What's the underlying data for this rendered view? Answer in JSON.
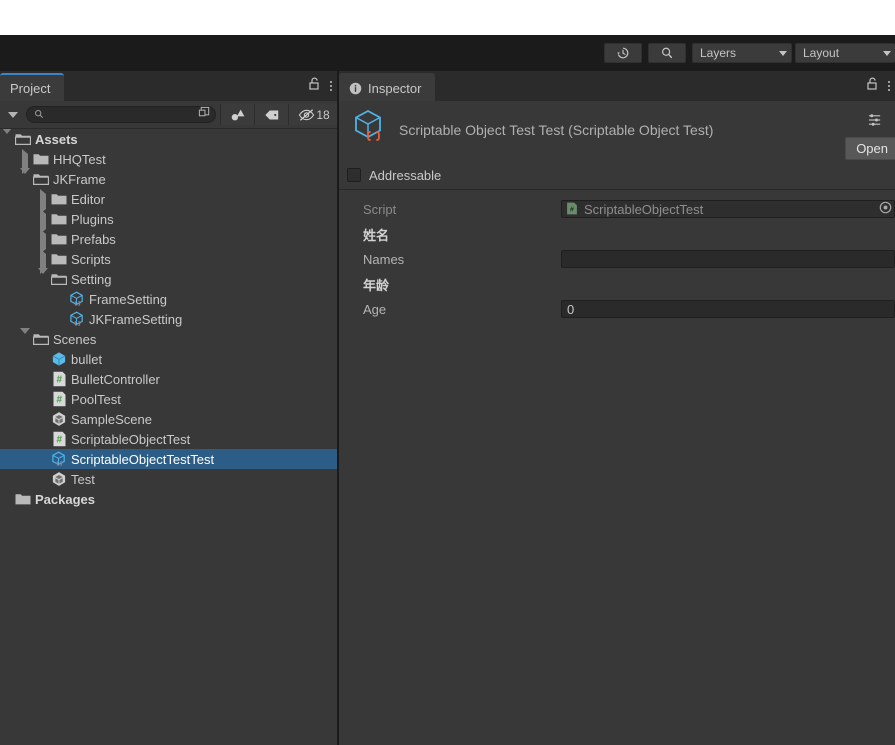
{
  "toolbar": {
    "history_icon": "history-icon",
    "search_icon": "search-icon",
    "layers_label": "Layers",
    "layout_label": "Layout"
  },
  "project_panel": {
    "tab_label": "Project",
    "lock_icon": "lock-icon",
    "menu_icon": "kebab-menu-icon",
    "search": {
      "placeholder": "",
      "value": "",
      "icon": "search-icon",
      "save_search_icon": "save-search-icon"
    },
    "filter_buttons": [
      {
        "name": "filter-by-type-icon",
        "label": ""
      },
      {
        "name": "filter-by-label-icon",
        "label": ""
      },
      {
        "name": "hidden-packages-icon",
        "label": "18"
      }
    ],
    "tree": [
      {
        "label": "Assets",
        "indent": 0,
        "twisty": "open",
        "icon": "folder-open-icon",
        "bold": true,
        "selected": false
      },
      {
        "label": "HHQTest",
        "indent": 1,
        "twisty": "closed",
        "icon": "folder-icon",
        "bold": false,
        "selected": false
      },
      {
        "label": "JKFrame",
        "indent": 1,
        "twisty": "open",
        "icon": "folder-open-icon",
        "bold": false,
        "selected": false
      },
      {
        "label": "Editor",
        "indent": 2,
        "twisty": "closed",
        "icon": "folder-icon",
        "bold": false,
        "selected": false
      },
      {
        "label": "Plugins",
        "indent": 2,
        "twisty": "closed",
        "icon": "folder-icon",
        "bold": false,
        "selected": false
      },
      {
        "label": "Prefabs",
        "indent": 2,
        "twisty": "closed",
        "icon": "folder-icon",
        "bold": false,
        "selected": false
      },
      {
        "label": "Scripts",
        "indent": 2,
        "twisty": "closed",
        "icon": "folder-icon",
        "bold": false,
        "selected": false
      },
      {
        "label": "Setting",
        "indent": 2,
        "twisty": "open",
        "icon": "folder-open-icon",
        "bold": false,
        "selected": false
      },
      {
        "label": "FrameSetting",
        "indent": 3,
        "twisty": "none",
        "icon": "scriptable-object-icon",
        "bold": false,
        "selected": false
      },
      {
        "label": "JKFrameSetting",
        "indent": 3,
        "twisty": "none",
        "icon": "scriptable-object-icon",
        "bold": false,
        "selected": false
      },
      {
        "label": "Scenes",
        "indent": 1,
        "twisty": "open",
        "icon": "folder-open-icon",
        "bold": false,
        "selected": false
      },
      {
        "label": "bullet",
        "indent": 2,
        "twisty": "none",
        "icon": "prefab-icon",
        "bold": false,
        "selected": false
      },
      {
        "label": "BulletController",
        "indent": 2,
        "twisty": "none",
        "icon": "cs-script-icon",
        "bold": false,
        "selected": false
      },
      {
        "label": "PoolTest",
        "indent": 2,
        "twisty": "none",
        "icon": "cs-script-icon",
        "bold": false,
        "selected": false
      },
      {
        "label": "SampleScene",
        "indent": 2,
        "twisty": "none",
        "icon": "unity-scene-icon",
        "bold": false,
        "selected": false
      },
      {
        "label": "ScriptableObjectTest",
        "indent": 2,
        "twisty": "none",
        "icon": "cs-script-icon",
        "bold": false,
        "selected": false
      },
      {
        "label": "ScriptableObjectTestTest",
        "indent": 2,
        "twisty": "none",
        "icon": "scriptable-object-icon",
        "bold": false,
        "selected": true
      },
      {
        "label": "Test",
        "indent": 2,
        "twisty": "none",
        "icon": "unity-scene-icon",
        "bold": false,
        "selected": false
      },
      {
        "label": "Packages",
        "indent": 0,
        "twisty": "none",
        "icon": "folder-icon",
        "bold": true,
        "selected": false
      }
    ]
  },
  "inspector_panel": {
    "tab_label": "Inspector",
    "tab_icon": "info-icon",
    "lock_icon": "lock-icon",
    "menu_icon": "kebab-menu-icon",
    "asset_icon": "scriptable-object-icon",
    "asset_title": "Scriptable Object Test Test (Scriptable Object Test)",
    "preset_icon": "preset-icon",
    "open_button": "Open",
    "addressable_label": "Addressable",
    "addressable_checked": false,
    "fields": [
      {
        "label": "Script",
        "type": "object",
        "value": "ScriptableObjectTest",
        "icon": "cs-script-icon",
        "header": false,
        "dim": true
      },
      {
        "label": "姓名",
        "type": "header",
        "value": "",
        "icon": "",
        "header": true,
        "dim": false
      },
      {
        "label": "Names",
        "type": "text",
        "value": "",
        "icon": "",
        "header": false,
        "dim": false
      },
      {
        "label": "年龄",
        "type": "header",
        "value": "",
        "icon": "",
        "header": true,
        "dim": false
      },
      {
        "label": "Age",
        "type": "text",
        "value": "0",
        "icon": "",
        "header": false,
        "dim": false
      }
    ]
  },
  "colors": {
    "panel_bg": "#383838",
    "window_bg": "#1b1b1b",
    "tab_bg": "#2b2b2b",
    "selection": "#2c5d87",
    "accent": "#3d84c6",
    "text": "#c9c9c9"
  }
}
